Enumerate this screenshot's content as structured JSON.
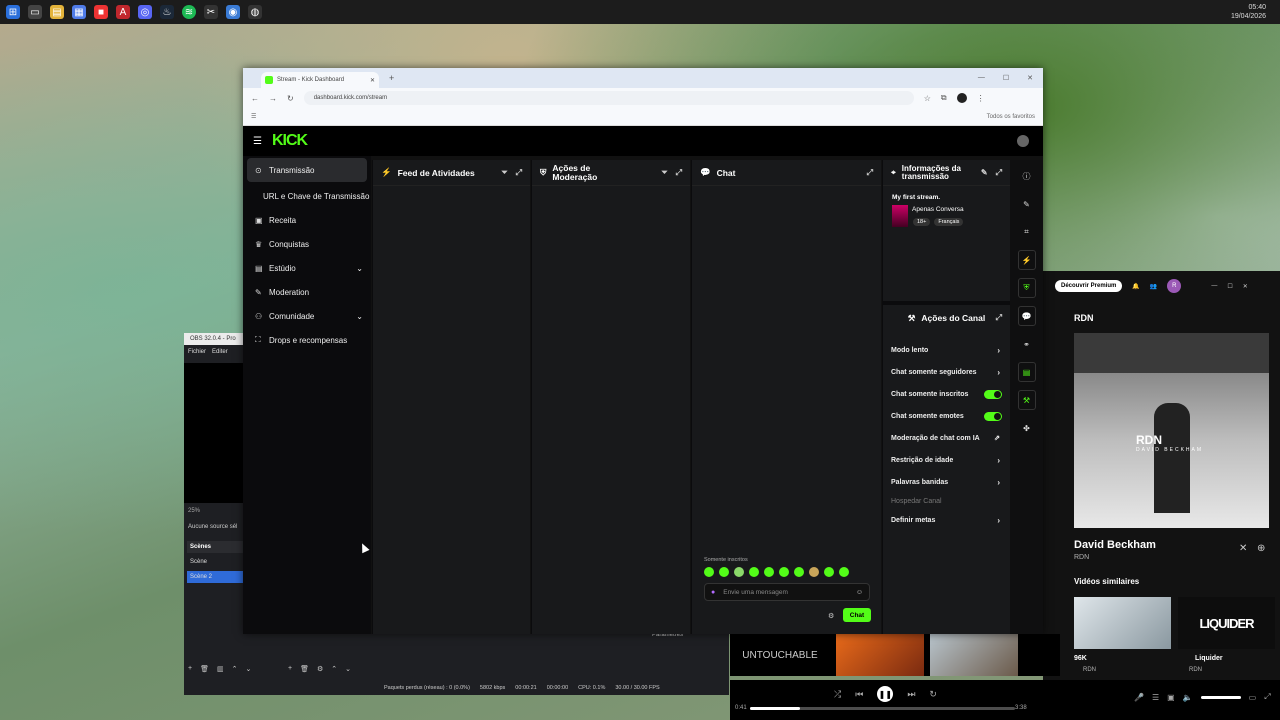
{
  "taskbar": {
    "clock_time": "05:40",
    "clock_date": "19/04/2026"
  },
  "browser": {
    "tab_title": "Stream - Kick Dashboard",
    "url": "dashboard.kick.com/stream",
    "bookmarks_label": "Todos os favoritos"
  },
  "kick": {
    "logo": "KICK",
    "sidebar": [
      {
        "label": "Transmissão",
        "icon": "broadcast-icon",
        "active": true
      },
      {
        "label": "URL e Chave de Transmissão",
        "icon": "",
        "active": false
      },
      {
        "label": "Receita",
        "icon": "money-icon",
        "active": false
      },
      {
        "label": "Conquistas",
        "icon": "trophy-icon",
        "active": false
      },
      {
        "label": "Estúdio",
        "icon": "studio-icon",
        "active": false,
        "chevron": true
      },
      {
        "label": "Moderation",
        "icon": "wrench-icon",
        "active": false
      },
      {
        "label": "Comunidade",
        "icon": "users-icon",
        "active": false,
        "chevron": true
      },
      {
        "label": "Drops e recompensas",
        "icon": "gift-icon",
        "active": false
      }
    ],
    "panels": {
      "feed": "Feed de Atividades",
      "moderation": "Ações de Moderação",
      "chat": "Chat",
      "info": "Informações da transmissão"
    },
    "stream_info": {
      "title": "My first stream.",
      "category": "Apenas Conversa",
      "tags": [
        "18+",
        "Français"
      ]
    },
    "chat": {
      "subs_only": "Somente inscritos",
      "placeholder": "Envie uma mensagem",
      "send_label": "Chat"
    },
    "channel_actions": {
      "title": "Ações do Canal",
      "items": [
        {
          "label": "Modo lento",
          "control": "arrow"
        },
        {
          "label": "Chat somente seguidores",
          "control": "arrow"
        },
        {
          "label": "Chat somente inscritos",
          "control": "toggle"
        },
        {
          "label": "Chat somente emotes",
          "control": "toggle"
        },
        {
          "label": "Moderação de chat com IA",
          "control": "external"
        },
        {
          "label": "Restrição de idade",
          "control": "arrow"
        },
        {
          "label": "Palavras banidas",
          "control": "arrow"
        },
        {
          "label": "Hospedar Canal",
          "control": "none",
          "muted": true
        },
        {
          "label": "Definir metas",
          "control": "arrow"
        }
      ]
    }
  },
  "obs": {
    "title": "OBS 32.0.4 - Pro",
    "menu": [
      "Fichier",
      "Editer"
    ],
    "zoom": "25%",
    "no_source": "Aucune source sél",
    "scenes_header": "Scènes",
    "scenes": [
      "Scène",
      "Scène 2"
    ],
    "params": "Paramètres",
    "status": {
      "dropped": "Paquets perdus (réseau) : 0 (0.0%)",
      "bitrate": "5802 kbps",
      "rec_time": "00:00:21",
      "stream_time": "00:00:00",
      "cpu": "CPU: 0.1%",
      "fps": "30.00 / 30.00 FPS"
    }
  },
  "spotify": {
    "premium": "Découvrir Premium",
    "avatar": "R",
    "artist_header": "RDN",
    "cover_text": "RDN",
    "cover_sub": "DAVID BECKHAM",
    "track": "David Beckham",
    "artist": "RDN",
    "similar": "Vidéos similaires",
    "videos": [
      {
        "title": "96K",
        "artist": "RDN"
      },
      {
        "title": "Liquider",
        "artist": "RDN",
        "thumb": "LIQUIDER"
      }
    ],
    "strip_text": "UNTOUCHABLE",
    "time_current": "0:41",
    "time_total": "3:38",
    "progress": 0.19
  }
}
